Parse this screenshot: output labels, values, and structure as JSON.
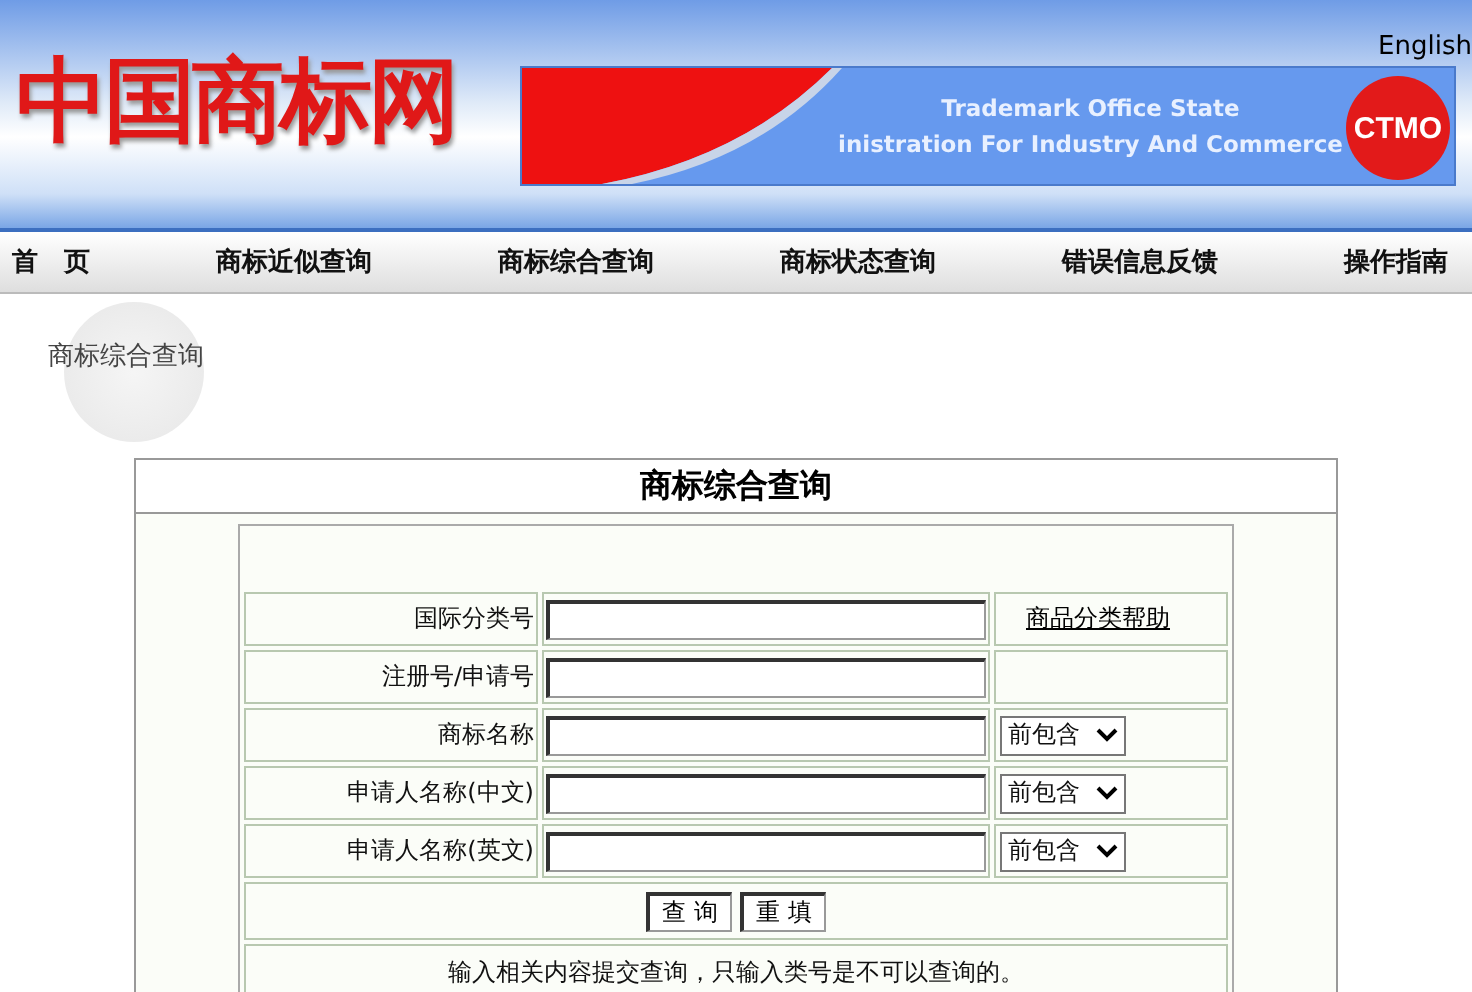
{
  "header": {
    "logo": "中国商标网",
    "language_link": "English",
    "banner": {
      "line_1": "Trademark Office State",
      "line_2": "inistration For Industry And Commerce",
      "badge": "CTMO"
    }
  },
  "nav": [
    {
      "label": "首　页"
    },
    {
      "label": "商标近似查询"
    },
    {
      "label": "商标综合查询"
    },
    {
      "label": "商标状态查询"
    },
    {
      "label": "错误信息反馈"
    },
    {
      "label": "操作指南"
    }
  ],
  "breadcrumb": "商标综合查询",
  "form": {
    "title": "商标综合查询",
    "rows": [
      {
        "kind": "text",
        "label": "国际分类号",
        "link": "商品分类帮助"
      },
      {
        "kind": "text",
        "label": "注册号/申请号"
      },
      {
        "kind": "select",
        "label": "商标名称",
        "option": "前包含"
      },
      {
        "kind": "select",
        "label": "申请人名称(中文)",
        "option": "前包含"
      },
      {
        "kind": "select",
        "label": "申请人名称(英文)",
        "option": "前包含"
      }
    ],
    "buttons": [
      "查 询",
      "重 填"
    ],
    "note": "输入相关内容提交查询，只输入类号是不可以查询的。"
  }
}
